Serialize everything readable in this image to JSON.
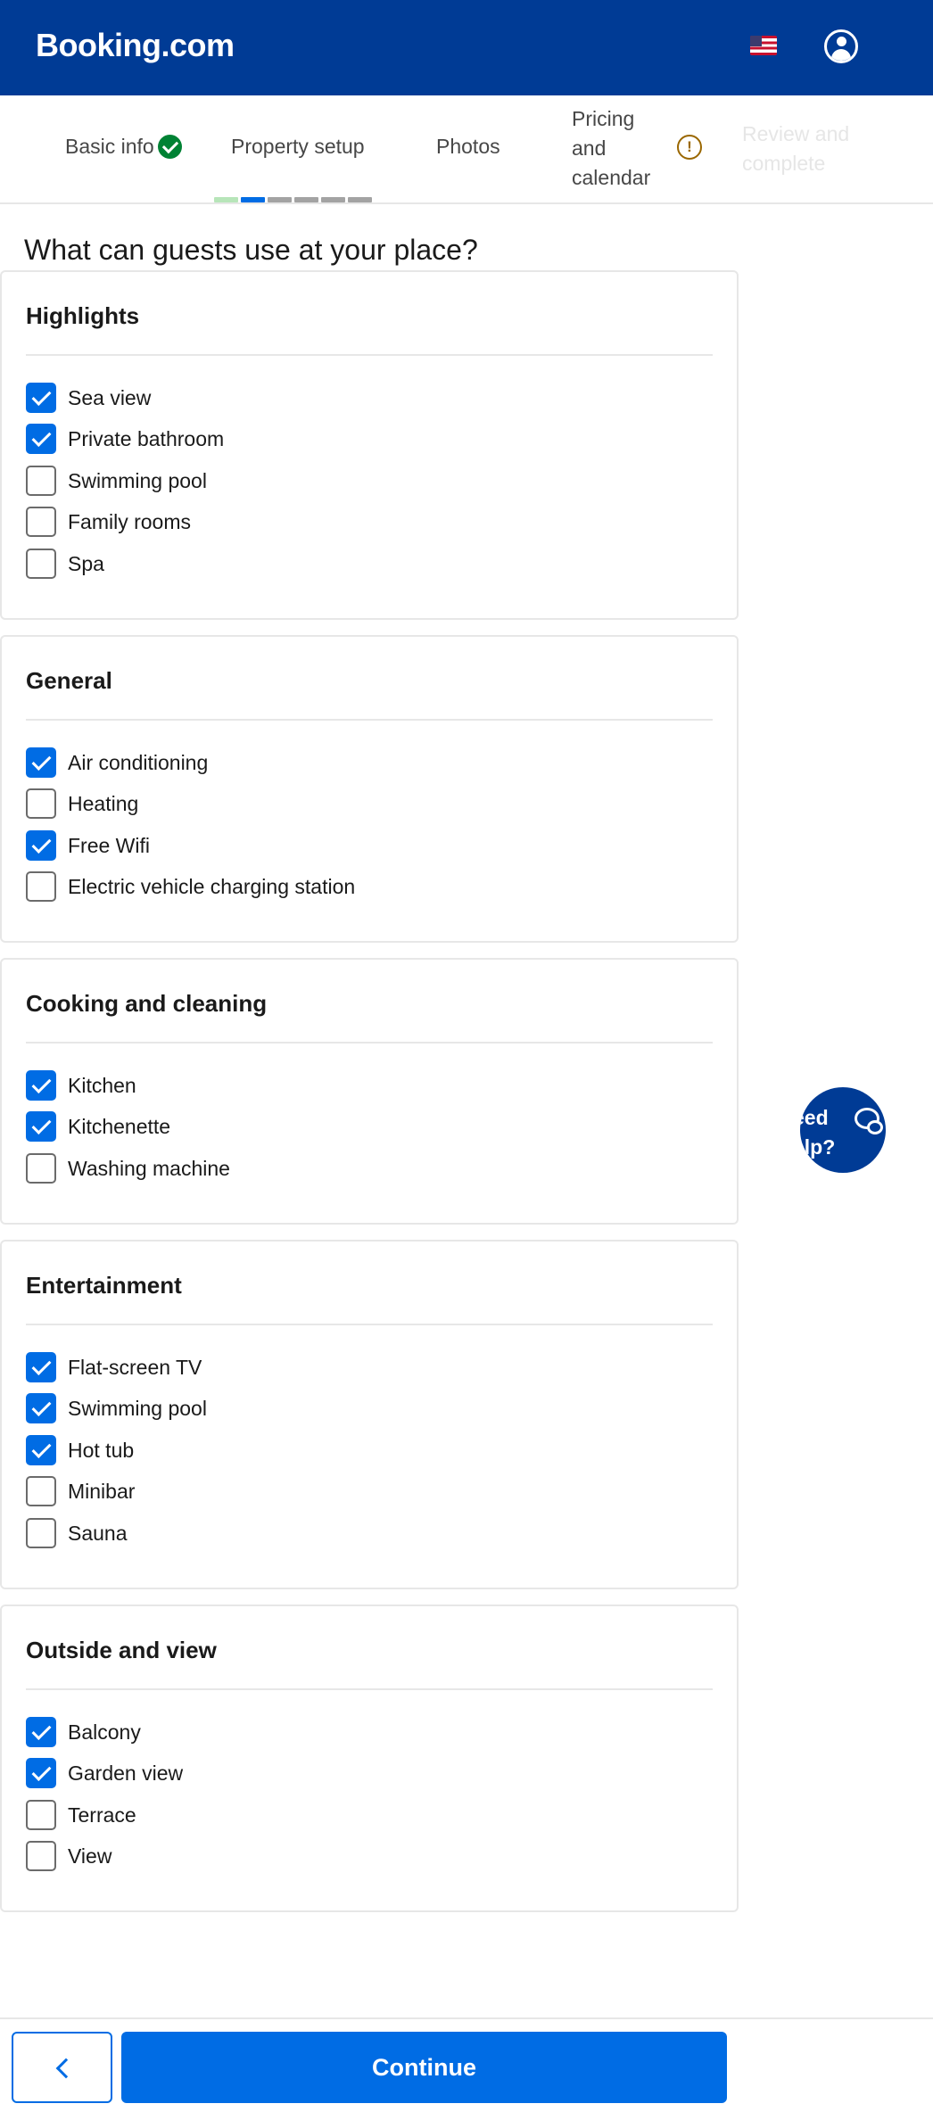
{
  "header": {
    "logo": "Booking.com",
    "flag_icon": "us-flag-icon",
    "user_icon": "account-icon"
  },
  "stepper": {
    "steps": [
      {
        "label": "Basic info",
        "status": "complete"
      },
      {
        "label": "Property setup",
        "status": "current"
      },
      {
        "label": "Photos",
        "status": "upcoming"
      },
      {
        "label": "Pricing and calendar",
        "status": "warning"
      },
      {
        "label": "Review and complete",
        "status": "disabled"
      }
    ],
    "progress_colors": [
      "#b7e5b9",
      "#006ce4",
      "#a3a3a3",
      "#a3a3a3",
      "#a3a3a3",
      "#a3a3a3"
    ],
    "warning_glyph": "!"
  },
  "page": {
    "title": "What can guests use at your place?"
  },
  "sections": [
    {
      "title": "Highlights",
      "options": [
        {
          "label": "Sea view",
          "checked": true
        },
        {
          "label": "Private bathroom",
          "checked": true
        },
        {
          "label": "Swimming pool",
          "checked": false
        },
        {
          "label": "Family rooms",
          "checked": false
        },
        {
          "label": "Spa",
          "checked": false
        }
      ]
    },
    {
      "title": "General",
      "options": [
        {
          "label": "Air conditioning",
          "checked": true
        },
        {
          "label": "Heating",
          "checked": false
        },
        {
          "label": "Free Wifi",
          "checked": true
        },
        {
          "label": "Electric vehicle charging station",
          "checked": false
        }
      ]
    },
    {
      "title": "Cooking and cleaning",
      "options": [
        {
          "label": "Kitchen",
          "checked": true
        },
        {
          "label": "Kitchenette",
          "checked": true
        },
        {
          "label": "Washing machine",
          "checked": false
        }
      ]
    },
    {
      "title": "Entertainment",
      "options": [
        {
          "label": "Flat-screen TV",
          "checked": true
        },
        {
          "label": "Swimming pool",
          "checked": true
        },
        {
          "label": "Hot tub",
          "checked": true
        },
        {
          "label": "Minibar",
          "checked": false
        },
        {
          "label": "Sauna",
          "checked": false
        }
      ]
    },
    {
      "title": "Outside and view",
      "options": [
        {
          "label": "Balcony",
          "checked": true
        },
        {
          "label": "Garden view",
          "checked": true
        },
        {
          "label": "Terrace",
          "checked": false
        },
        {
          "label": "View",
          "checked": false
        }
      ]
    }
  ],
  "help": {
    "line1": "eed",
    "line2": "elp?"
  },
  "footer": {
    "continue_label": "Continue"
  },
  "colors": {
    "brand": "#003b95",
    "primary": "#006ce4",
    "success": "#008234",
    "warning": "#9a6700"
  }
}
